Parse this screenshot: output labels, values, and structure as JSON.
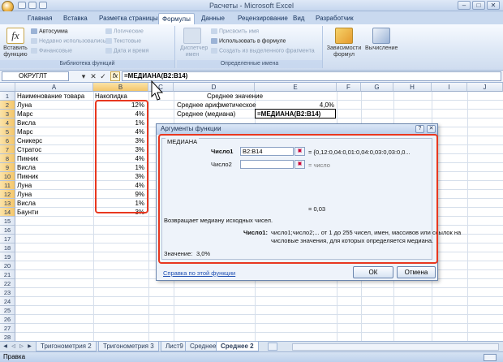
{
  "window": {
    "title": "Расчеты - Microsoft Excel",
    "min": "–",
    "max": "□",
    "close": "✕"
  },
  "tabs": [
    "Главная",
    "Вставка",
    "Разметка страницы",
    "Формулы",
    "Данные",
    "Рецензирование",
    "Вид",
    "Разработчик"
  ],
  "active_tab": "Формулы",
  "ribbon": {
    "insert_function": "Вставить функцию",
    "autosum": "Автосумма",
    "recently_used": "Недавно использовались",
    "financial": "Финансовые",
    "logical": "Логические",
    "text": "Текстовые",
    "date_time": "Дата и время",
    "group_library": "Библиотека функций",
    "name_manager": "Диспетчер имен",
    "assign_name": "Присвоить имя",
    "use_in_formula": "Использовать в формуле",
    "create_from_selection": "Создать из выделенного фрагмента",
    "group_names": "Определенные имена",
    "dependencies": "Зависимости формул",
    "calculation": "Вычисление"
  },
  "formula_bar": {
    "name_box": "ОКРУГЛТ",
    "cancel": "✕",
    "enter": "✓",
    "fx": "fx",
    "formula": "=МЕДИАНА(B2:B14)"
  },
  "columns": [
    "A",
    "B",
    "C",
    "D",
    "E",
    "F",
    "G",
    "H",
    "I",
    "J"
  ],
  "rows": [
    "1",
    "2",
    "3",
    "4",
    "5",
    "6",
    "7",
    "8",
    "9",
    "10",
    "11",
    "12",
    "13",
    "14",
    "15",
    "16",
    "17",
    "18",
    "19",
    "20",
    "21",
    "22",
    "23",
    "24",
    "25",
    "26",
    "27",
    "28"
  ],
  "table": {
    "header_a": "Наименование товара",
    "header_b": "Накопидка",
    "items": [
      {
        "name": "Луна",
        "value": "12%"
      },
      {
        "name": "Марс",
        "value": "4%"
      },
      {
        "name": "Висла",
        "value": "1%"
      },
      {
        "name": "Марс",
        "value": "4%"
      },
      {
        "name": "Сникерс",
        "value": "3%"
      },
      {
        "name": "Стратос",
        "value": "3%"
      },
      {
        "name": "Пикник",
        "value": "4%"
      },
      {
        "name": "Висла",
        "value": "1%"
      },
      {
        "name": "Пикник",
        "value": "3%"
      },
      {
        "name": "Луна",
        "value": "4%"
      },
      {
        "name": "Луна",
        "value": "9%"
      },
      {
        "name": "Висла",
        "value": "1%"
      },
      {
        "name": "Баунти",
        "value": "3%"
      }
    ]
  },
  "summary": {
    "title": "Среднее значение",
    "mean_label": "Среднее арифметическое",
    "mean_value": "4,0%",
    "median_label": "Среднее (медиана)",
    "median_formula": "=МЕДИАНА(B2:B14)"
  },
  "dialog": {
    "title": "Аргументы функции",
    "help_btn": "?",
    "close_btn": "✕",
    "function_name": "МЕДИАНА",
    "arg1_label": "Число1",
    "arg1_value": "B2:B14",
    "arg1_result": "= {0,12:0,04:0,01:0,04:0,03:0,03:0,0...",
    "arg2_label": "Число2",
    "arg2_result": "= число",
    "result_line": "= 0,03",
    "description": "Возвращает медиану исходных чисел.",
    "arg_help_label": "Число1:",
    "arg_help_line1": "число1;число2;... от 1 до 255 чисел, имен, массивов или ссылок на",
    "arg_help_line2": "числовые значения, для которых определяется медиана.",
    "value_label": "Значение:",
    "value": "3,0%",
    "help_link": "Справка по этой функции",
    "ok": "ОК",
    "cancel": "Отмена"
  },
  "sheets": [
    "Тригонометрия 2",
    "Тригонометрия 3",
    "Лист9",
    "Среднее",
    "Среднее 2"
  ],
  "active_sheet": "Среднее 2",
  "status": "Правка",
  "colors": {
    "accent": "#e8371f",
    "ribbon": "#dce7f5",
    "selected_header": "#f4c66a"
  }
}
